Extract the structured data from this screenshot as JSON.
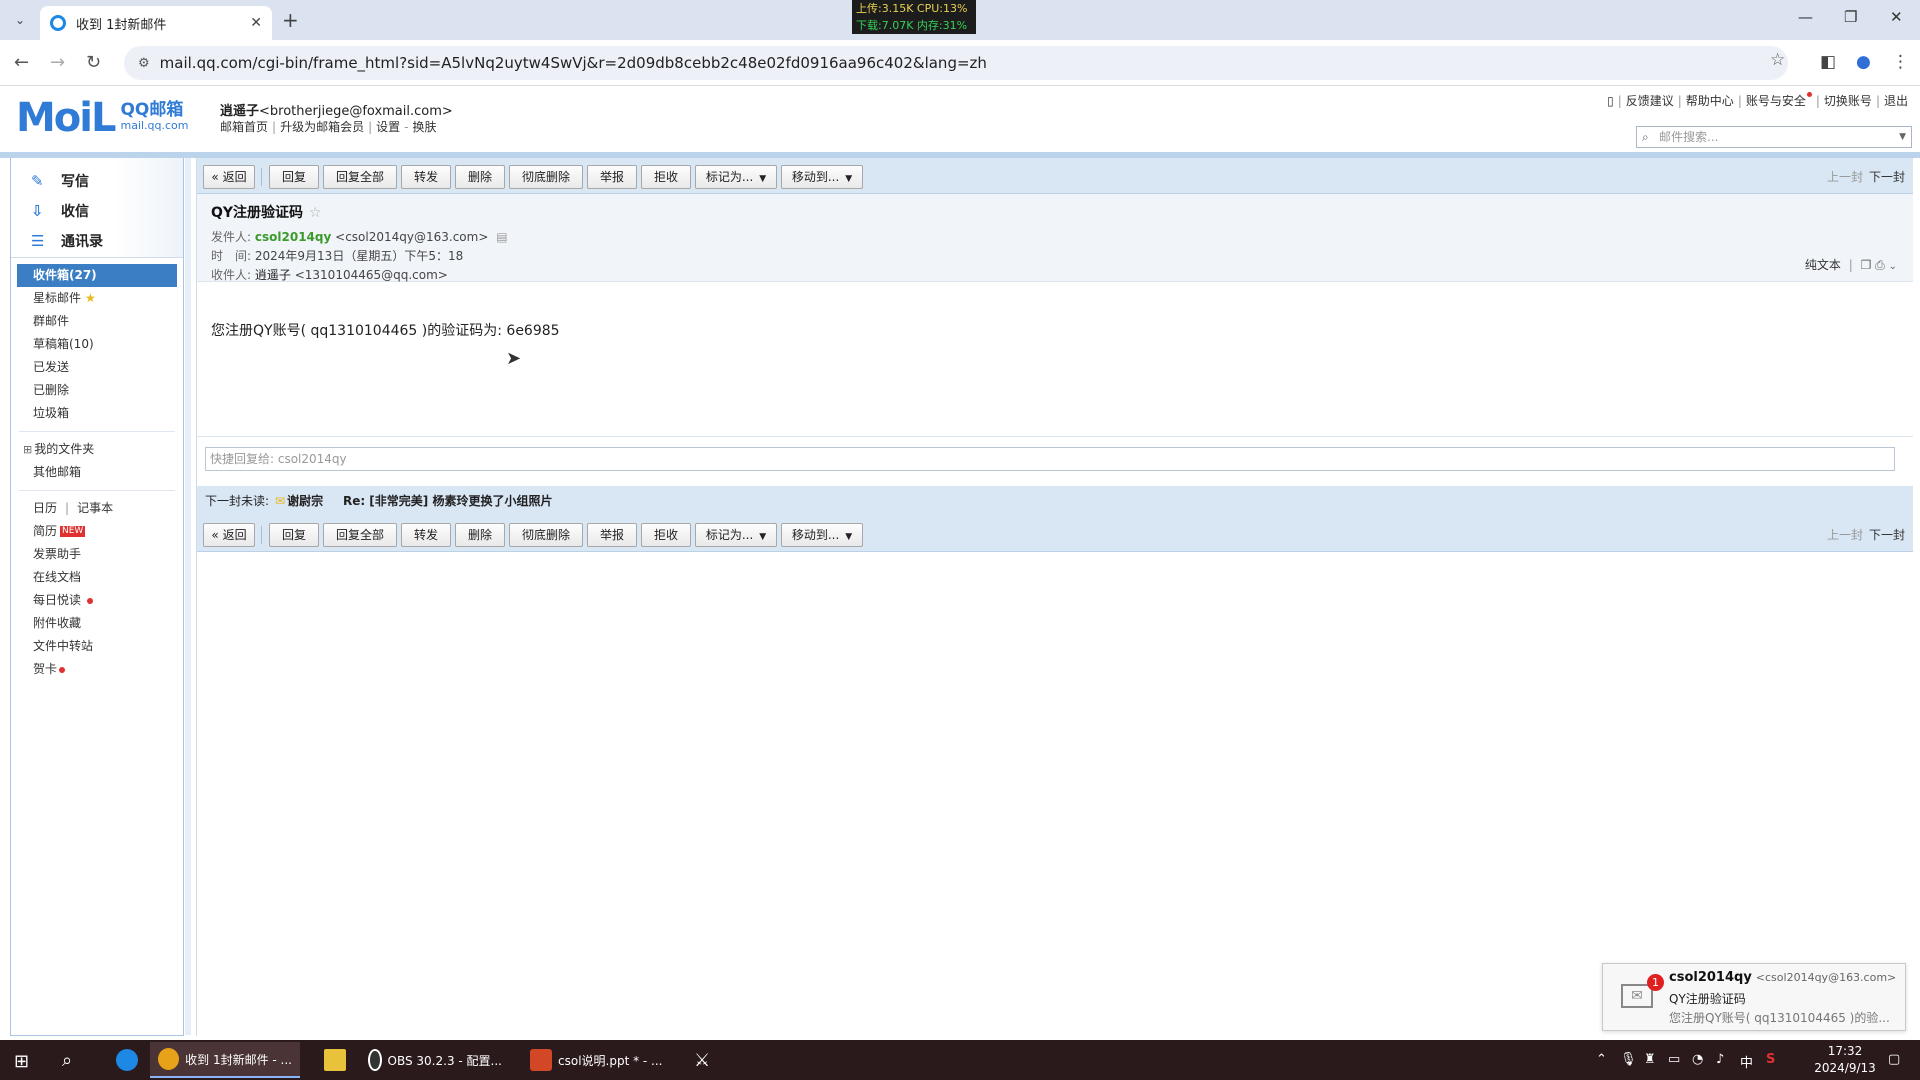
{
  "browser": {
    "tab_title": "收到 1封新邮件",
    "url": "mail.qq.com/cgi-bin/frame_html?sid=A5lvNq2uytw4SwVj&r=2d09db8cebb2c48e02fd0916aa96c402&lang=zh",
    "netstat": {
      "up": "上传:3.15K",
      "cpu": "CPU:13%",
      "down": "下载:7.07K",
      "mem": "内存:31%"
    }
  },
  "header": {
    "logo_main": "MoiL",
    "logo_brand": "QQ邮箱",
    "logo_domain": "mail.qq.com",
    "user_name": "逍遥子",
    "user_email": "<brotherjiege@foxmail.com>",
    "sublinks": [
      "邮箱首页",
      "升级为邮箱会员",
      "设置",
      "换肤"
    ],
    "toplinks": [
      "反馈建议",
      "帮助中心",
      "账号与安全",
      "切换账号",
      "退出"
    ],
    "search_placeholder": "邮件搜索..."
  },
  "sidebar": {
    "actions": [
      {
        "label": "写信",
        "icon": "pencil-icon"
      },
      {
        "label": "收信",
        "icon": "inbox-icon"
      },
      {
        "label": "通讯录",
        "icon": "contacts-icon"
      }
    ],
    "folders": [
      {
        "label": "收件箱(27)"
      },
      {
        "label": "星标邮件"
      },
      {
        "label": "群邮件"
      },
      {
        "label": "草稿箱(10)"
      },
      {
        "label": "已发送"
      },
      {
        "label": "已删除"
      },
      {
        "label": "垃圾箱"
      }
    ],
    "my_folders": "我的文件夹",
    "other_mailbox": "其他邮箱",
    "tools": {
      "calendar": "日历",
      "notepad": "记事本",
      "resume": "简历",
      "resume_badge": "NEW",
      "invoice": "发票助手",
      "docs": "在线文档",
      "daily": "每日悦读",
      "attachments": "附件收藏",
      "transfer": "文件中转站",
      "card": "贺卡"
    }
  },
  "toolbar": {
    "back": "« 返回",
    "reply": "回复",
    "reply_all": "回复全部",
    "forward": "转发",
    "delete": "删除",
    "delete_perm": "彻底删除",
    "report": "举报",
    "reject": "拒收",
    "mark_as": "标记为...",
    "move_to": "移动到...",
    "prev": "上一封",
    "next": "下一封"
  },
  "mail": {
    "subject": "QY注册验证码",
    "from_label": "发件人:",
    "from_name": "csol2014qy",
    "from_email": "<csol2014qy@163.com>",
    "time_label": "时　间:",
    "time_value": "2024年9月13日（星期五）下午5：18",
    "to_label": "收件人:",
    "to_name": "逍遥子",
    "to_email": "<1310104465@qq.com>",
    "plaintext": "纯文本",
    "body": "您注册QY账号( qq1310104465 )的验证码为: 6e6985",
    "quick_reply_placeholder": "快捷回复给: csol2014qy",
    "next_unread_label": "下一封未读:",
    "next_unread_from": "谢尉宗",
    "next_unread_subject": "Re: [非常完美] 杨素玲更换了小组照片"
  },
  "notification": {
    "badge": "1",
    "from": "csol2014qy",
    "from_email": "<csol2014qy@163.com>",
    "subject": "QY注册验证码",
    "preview": "您注册QY账号( qq1310104465 )的验..."
  },
  "taskbar": {
    "apps": [
      {
        "label": "收到 1封新邮件 - ..."
      },
      {
        "label": "OBS 30.2.3 - 配置..."
      },
      {
        "label": "csol说明.ppt * - ..."
      }
    ],
    "ime": "中",
    "time": "17:32",
    "date": "2024/9/13"
  }
}
